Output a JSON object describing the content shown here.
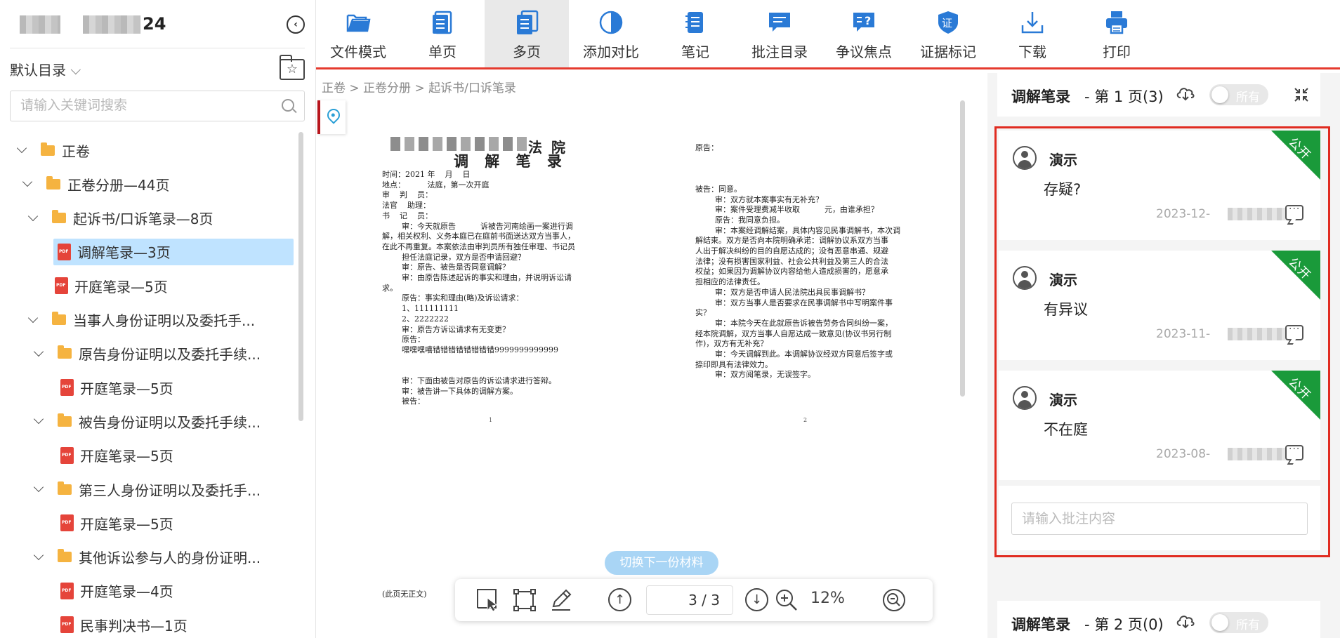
{
  "sidebar": {
    "case_title_suffix": "24",
    "catalog_label": "默认目录",
    "search_placeholder": "请输入关键词搜索",
    "tree": [
      {
        "label": "正卷",
        "type": "folder",
        "depth": 0
      },
      {
        "label": "正卷分册—44页",
        "type": "folder",
        "depth": 1
      },
      {
        "label": "起诉书/口诉笔录—8页",
        "type": "folder",
        "depth": 2
      },
      {
        "label": "调解笔录—3页",
        "type": "pdf",
        "depth": 3,
        "selected": true
      },
      {
        "label": "开庭笔录—5页",
        "type": "pdf",
        "depth": 3
      },
      {
        "label": "当事人身份证明以及委托手...",
        "type": "folder",
        "depth": 2
      },
      {
        "label": "原告身份证明以及委托手续...",
        "type": "folder",
        "depth": 3
      },
      {
        "label": "开庭笔录—5页",
        "type": "pdf",
        "depth": 4
      },
      {
        "label": "被告身份证明以及委托手续...",
        "type": "folder",
        "depth": 3
      },
      {
        "label": "开庭笔录—5页",
        "type": "pdf",
        "depth": 4
      },
      {
        "label": "第三人身份证明以及委托手...",
        "type": "folder",
        "depth": 3
      },
      {
        "label": "开庭笔录—5页",
        "type": "pdf",
        "depth": 4
      },
      {
        "label": "其他诉讼参与人的身份证明...",
        "type": "folder",
        "depth": 3
      },
      {
        "label": "开庭笔录—4页",
        "type": "pdf",
        "depth": 4
      },
      {
        "label": "民事判决书—1页",
        "type": "pdf",
        "depth": 4
      }
    ]
  },
  "toolbar": {
    "items": [
      {
        "label": "文件模式",
        "icon": "folder-open-icon"
      },
      {
        "label": "单页",
        "icon": "single-page-icon"
      },
      {
        "label": "多页",
        "icon": "multi-page-icon",
        "active": true
      },
      {
        "label": "添加对比",
        "icon": "compare-icon"
      },
      {
        "label": "笔记",
        "icon": "notes-icon"
      },
      {
        "label": "批注目录",
        "icon": "annotation-list-icon"
      },
      {
        "label": "争议焦点",
        "icon": "dispute-focus-icon"
      },
      {
        "label": "证据标记",
        "icon": "evidence-mark-icon"
      },
      {
        "label": "下载",
        "icon": "download-icon"
      },
      {
        "label": "打印",
        "icon": "print-icon"
      }
    ],
    "accent": "#2a7ad6",
    "divider_color": "#e53a2e"
  },
  "breadcrumb": "正卷 > 正卷分册 > 起诉书/口诉笔录",
  "document": {
    "court_suffix": "法 院",
    "heading": "调 解 笔 录",
    "left_lines": [
      "时间：2021 年    月    日",
      "地点：         法庭，第一次开庭",
      "审    判    员：",
      "法官    助理：",
      "书    记    员：",
      "        审：今天就原告          诉被告河南绘画一案进行调",
      "解，相关权利、义务本庭已在庭前书面送达双方当事人，",
      "在此不再重复。本案依法由审判员所有独任审理、书记员",
      "        担任法庭记录，双方是否申请回避？",
      "        审：原告、被告是否同意调解？",
      "        审：由原告陈述起诉的事实和理由，并说明诉讼请",
      "求。",
      "        原告：事实和理由(略)及诉讼请求：",
      "        1、111111111",
      "        2、2222222",
      "        审：原告方诉讼请求有无变更？",
      "        原告：",
      "        嘿嘿嘿嘻错错错错错错错错9999999999999",
      "",
      "",
      "        审：下面由被告对原告的诉讼请求进行答辩。",
      "        审：被告讲一下具体的调解方案。",
      "        被告："
    ],
    "right_lines": [
      "原告：",
      "",
      "",
      "",
      "被告：同意。",
      "        审：双方就本案事实有无补充？",
      "        审：案件受理费减半收取          元，由谁承担？",
      "        原告：我同意负担。",
      "        审：本案经调解结案，具体内容见民事调解书，本次调",
      "解结束。双方是否向本院明确承诺：调解协议系双方当事",
      "人出于解决纠纷的目的自愿达成的；没有恶意串通、规避",
      "法律；没有损害国家利益、社会公共利益及第三人的合法",
      "权益；如果因为调解协议内容给他人造成损害的，愿意承",
      "担相应的法律责任。",
      "        审：双方是否申请人民法院出具民事调解书？",
      "        审：双方当事人是否要求在民事调解书中写明案件事",
      "实？",
      "        审：本院今天在此就原告诉被告劳务合同纠纷一案，",
      "经本院调解，双方当事人自愿达成一致意见(协议书另行制",
      "作)，双方有无补充？",
      "        审：今天调解到此。本调解协议经双方同意后签字或",
      "捺印即具有法律效力。",
      "        审：双方阅笔录，无误签字。"
    ],
    "page_left": "1",
    "page_right": "2",
    "footnote": "(此页无正文)"
  },
  "viewer": {
    "switch_material": "切换下一份材料",
    "page_indicator": "3 / 3",
    "zoom": "12%"
  },
  "notes": {
    "header_1": {
      "title": "调解笔录",
      "page": "- 第 1 页(3)",
      "toggle_label": "所有"
    },
    "header_2": {
      "title": "调解笔录",
      "page": "- 第 2 页(0)",
      "toggle_label": "所有"
    },
    "items": [
      {
        "user": "演示",
        "text": "存疑?",
        "date": "2023-12-",
        "badge": "公开"
      },
      {
        "user": "演示",
        "text": "有异议",
        "date": "2023-11-",
        "badge": "公开"
      },
      {
        "user": "演示",
        "text": "不在庭",
        "date": "2023-08-",
        "badge": "公开"
      }
    ],
    "input_placeholder": "请输入批注内容",
    "badge_color": "#1a9a3a",
    "highlight_color": "#e02b20"
  }
}
